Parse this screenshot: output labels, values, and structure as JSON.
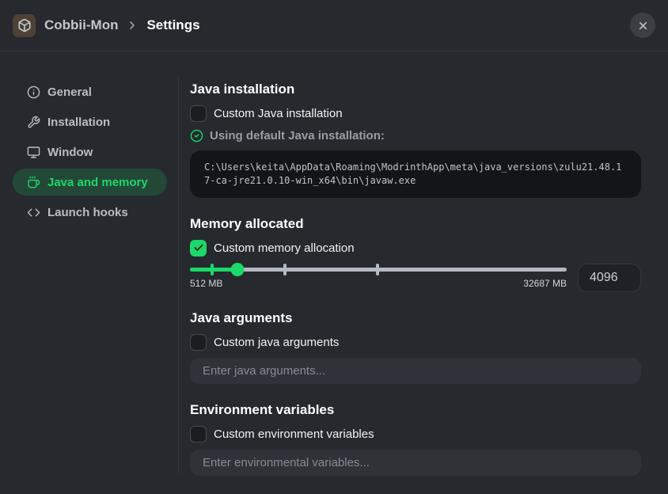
{
  "header": {
    "instance_name": "Cobbii-Mon",
    "page_title": "Settings"
  },
  "sidebar": {
    "items": [
      {
        "label": "General",
        "icon": "info-icon",
        "active": false
      },
      {
        "label": "Installation",
        "icon": "wrench-icon",
        "active": false
      },
      {
        "label": "Window",
        "icon": "monitor-icon",
        "active": false
      },
      {
        "label": "Java and memory",
        "icon": "coffee-icon",
        "active": true
      },
      {
        "label": "Launch hooks",
        "icon": "code-icon",
        "active": false
      }
    ]
  },
  "java_installation": {
    "heading": "Java installation",
    "custom_label": "Custom Java installation",
    "custom_checked": false,
    "default_status": "Using default Java installation:",
    "default_path": "C:\\Users\\keita\\AppData\\Roaming\\ModrinthApp\\meta\\java_versions\\zulu21.48.17-ca-jre21.0.10-win_x64\\bin\\javaw.exe"
  },
  "memory": {
    "heading": "Memory allocated",
    "custom_label": "Custom memory allocation",
    "custom_checked": true,
    "slider": {
      "min_label": "512 MB",
      "max_label": "32687 MB",
      "value": "4096",
      "fill_percent": 12.6,
      "tick_percents": [
        5.9,
        25.2,
        49.8
      ]
    }
  },
  "java_arguments": {
    "heading": "Java arguments",
    "custom_label": "Custom java arguments",
    "custom_checked": false,
    "placeholder": "Enter java arguments..."
  },
  "environment_variables": {
    "heading": "Environment variables",
    "custom_label": "Custom environment variables",
    "custom_checked": false,
    "placeholder": "Enter environmental variables..."
  },
  "colors": {
    "accent_green": "#1bd96a",
    "background": "#26292e",
    "code_background": "#141519",
    "active_pill": "rgba(27,217,106,0.18)"
  }
}
